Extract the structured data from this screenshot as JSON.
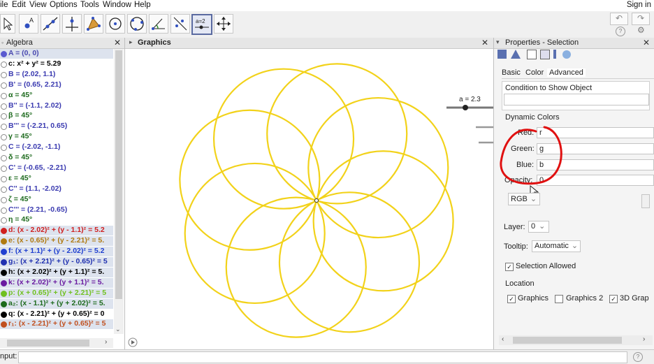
{
  "menu": [
    "ile",
    "Edit",
    "View",
    "Options",
    "Tools",
    "Window",
    "Help"
  ],
  "signin": "Sign in",
  "toolbar": {
    "tools": [
      "move-tool",
      "point-tool",
      "line-tool",
      "perpendicular-tool",
      "polygon-tool",
      "circle-center-tool",
      "circle-three-points-tool",
      "angle-tool",
      "reflect-tool",
      "slider-tool",
      "move-graphics-tool"
    ],
    "slider_icon_text": "a=2",
    "undo": "↶",
    "redo": "↷",
    "help": "?",
    "settings": "⚙"
  },
  "algebra": {
    "title": "Algebra",
    "items": [
      {
        "text": "A = (0, 0)",
        "color": "#4a4ab0",
        "dot": "#5a5ad0",
        "hl": true
      },
      {
        "text": "c: x² + y² = 5.29",
        "color": "#000000",
        "dot": "#ffffff"
      },
      {
        "text": "B = (2.02, 1.1)",
        "color": "#3a3ab0",
        "dot": "#ffffff"
      },
      {
        "text": "B' = (0.65, 2.21)",
        "color": "#3a3ab0",
        "dot": "#ffffff"
      },
      {
        "text": "α = 45°",
        "color": "#1d6a1d",
        "dot": "#ffffff"
      },
      {
        "text": "B'' = (-1.1, 2.02)",
        "color": "#3a3ab0",
        "dot": "#ffffff"
      },
      {
        "text": "β = 45°",
        "color": "#1d6a1d",
        "dot": "#ffffff"
      },
      {
        "text": "B''' = (-2.21, 0.65)",
        "color": "#3a3ab0",
        "dot": "#ffffff"
      },
      {
        "text": "γ = 45°",
        "color": "#1d6a1d",
        "dot": "#ffffff"
      },
      {
        "text": "C = (-2.02, -1.1)",
        "color": "#3a3ab0",
        "dot": "#ffffff"
      },
      {
        "text": "δ = 45°",
        "color": "#1d6a1d",
        "dot": "#ffffff"
      },
      {
        "text": "C' = (-0.65, -2.21)",
        "color": "#3a3ab0",
        "dot": "#ffffff"
      },
      {
        "text": "ε = 45°",
        "color": "#1d6a1d",
        "dot": "#ffffff"
      },
      {
        "text": "C'' = (1.1, -2.02)",
        "color": "#3a3ab0",
        "dot": "#ffffff"
      },
      {
        "text": "ζ = 45°",
        "color": "#1d6a1d",
        "dot": "#ffffff"
      },
      {
        "text": "C''' = (2.21, -0.65)",
        "color": "#3a3ab0",
        "dot": "#ffffff"
      },
      {
        "text": "η = 45°",
        "color": "#1d6a1d",
        "dot": "#ffffff"
      },
      {
        "text": "d: (x - 2.02)² + (y - 1.1)² = 5.2",
        "color": "#d02020",
        "dot": "#d02020",
        "hl": true
      },
      {
        "text": "e: (x - 0.65)² + (y - 2.21)² = 5.",
        "color": "#b07a10",
        "dot": "#b07a10",
        "hl": true
      },
      {
        "text": "f: (x + 1.1)² + (y - 2.02)² = 5.2",
        "color": "#2040d0",
        "dot": "#2040d0",
        "hl": true
      },
      {
        "text": "g₁: (x + 2.21)² + (y - 0.65)² = 5",
        "color": "#2030b0",
        "dot": "#2030b0",
        "hl": true
      },
      {
        "text": "h: (x + 2.02)² + (y + 1.1)² = 5.",
        "color": "#000000",
        "dot": "#000000",
        "hl": true
      },
      {
        "text": "k: (x + 2.02)² + (y + 1.1)² = 5.",
        "color": "#6a1aa0",
        "dot": "#6a1aa0",
        "hl": true
      },
      {
        "text": "p: (x + 0.65)² + (y + 2.21)² = 5",
        "color": "#70c020",
        "dot": "#70c020",
        "hl": true
      },
      {
        "text": "a₂: (x - 1.1)² + (y + 2.02)² = 5.",
        "color": "#1d6a1d",
        "dot": "#1d6a1d",
        "hl": true
      },
      {
        "text": "q: (x - 2.21)² + (y + 0.65)² = 0",
        "color": "#000000",
        "dot": "#000000"
      },
      {
        "text": "r₁: (x - 2.21)² + (y + 0.65)² = 5",
        "color": "#c05020",
        "dot": "#c05020",
        "hl": true
      }
    ]
  },
  "graphics": {
    "title": "Graphics",
    "slider_label": "a = 2.3",
    "slider_value": 2.3,
    "circle_color": "#f2d21a"
  },
  "properties": {
    "title": "Properties - Selection",
    "tabs": [
      "Basic",
      "Color",
      "Advanced"
    ],
    "active_tab": "Advanced",
    "condition_label": "Condition to Show Object",
    "dynamic_colors_label": "Dynamic Colors",
    "red_label": "Red:",
    "red_value": "r",
    "green_label": "Green:",
    "green_value": "g",
    "blue_label": "Blue:",
    "blue_value": "b",
    "opacity_label": "Opacity:",
    "opacity_value": "0",
    "color_space": "RGB",
    "layer_label": "Layer:",
    "layer_value": "0",
    "tooltip_label": "Tooltip:",
    "tooltip_value": "Automatic",
    "selection_allowed": "Selection Allowed",
    "location_label": "Location",
    "loc_graphics": "Graphics",
    "loc_graphics2": "Graphics 2",
    "loc_3d": "3D Grap",
    "annotation_color": "#e01010"
  },
  "input": {
    "label": "nput:",
    "help": "?"
  }
}
